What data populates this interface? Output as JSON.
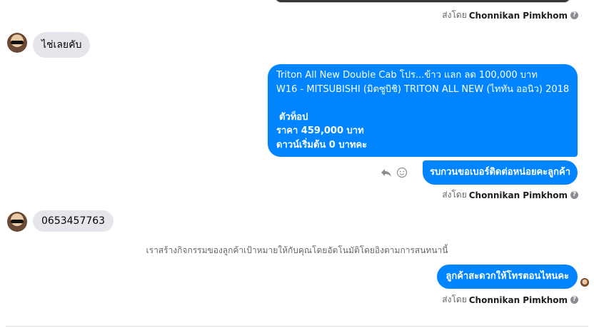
{
  "sender_prefix": "ส่งโดย",
  "sender_name": "Chonnikan Pimkhom",
  "messages": {
    "incoming_1": "ไช่เลยคับ",
    "outgoing_listing": {
      "line1": "Triton All New Double Cab โปร...ข้าว แลก ลด 100,000 บาท",
      "line2": "W16 - MITSUBISHI (มิตซูบิชิ) TRITON ALL NEW (ไททัน ออนิว) 2018",
      "line3": "ตัวท็อป",
      "line4": "ราคา 459,000 บาท",
      "line5": "ดาวน์เริ่มต้น 0 บาทคะ"
    },
    "outgoing_2": "รบกวนขอเบอร์ติดต่อหน่อยคะลูกค้า",
    "incoming_2": "0653457763",
    "system": "เราสร้างกิจกรรมของลูกค้าเป้าหมายให้กับคุณโดยอัตโนมัติโดยอิงตามการสนทนานี้",
    "outgoing_3": "ลูกค้าสะดวกให้โทรตอนไหนคะ"
  },
  "icons": {
    "reply": "reply-icon",
    "react": "emoji-icon",
    "info": "info-icon"
  },
  "colors": {
    "outgoing_bubble": "#0084ff",
    "incoming_bubble": "#e4e6eb"
  }
}
